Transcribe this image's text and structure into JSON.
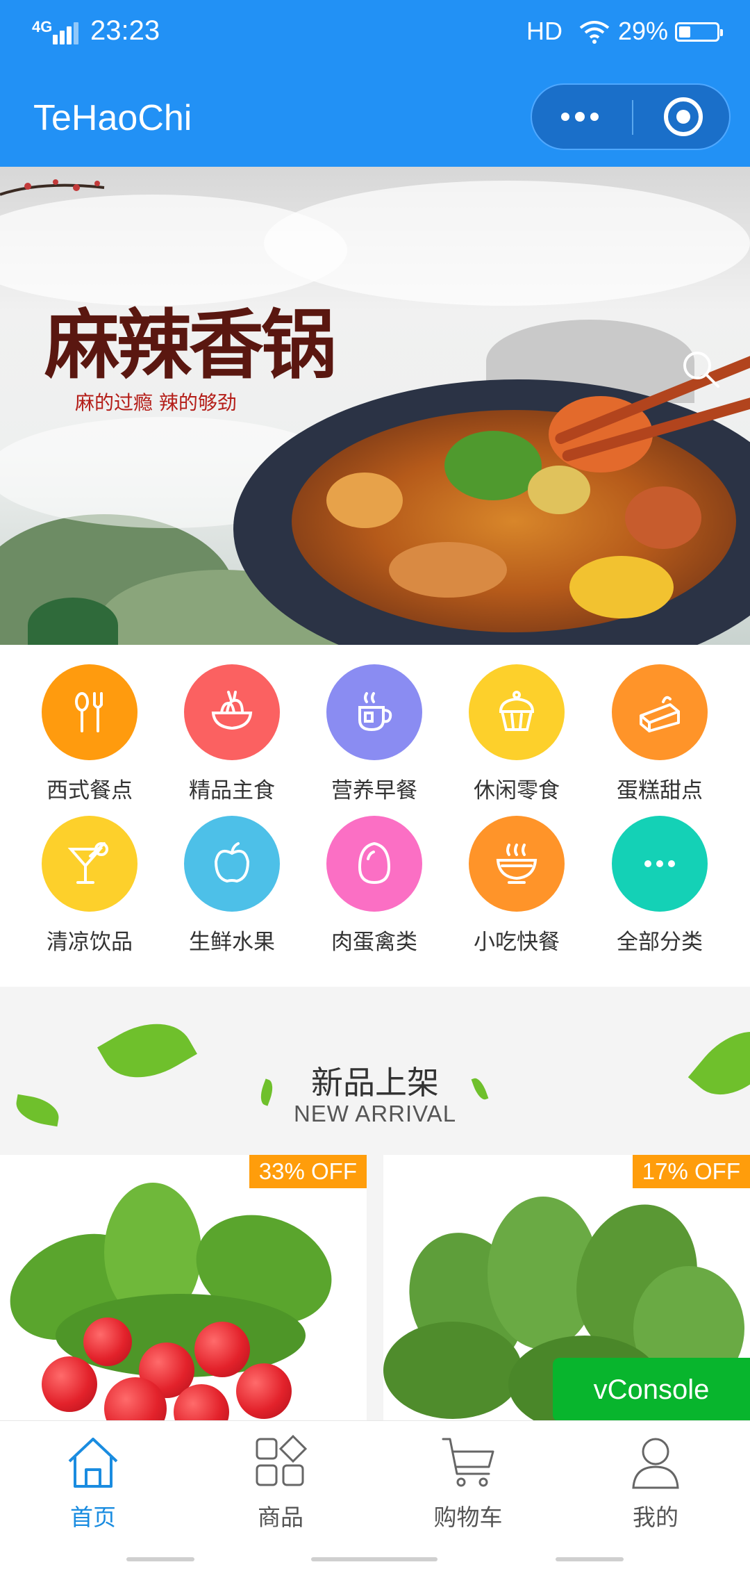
{
  "status_bar": {
    "network": "4G",
    "time": "23:23",
    "hd": "HD",
    "battery": "29%"
  },
  "header": {
    "title": "TeHaoChi"
  },
  "banner": {
    "calligraphy": "麻辣香锅",
    "slogan": "麻的过瘾 辣的够劲",
    "current_slide": 1
  },
  "categories": [
    {
      "label": "西式餐点",
      "color": "#ff9b0e",
      "icon": "fork-spoon-icon"
    },
    {
      "label": "精品主食",
      "color": "#fb6161",
      "icon": "noodle-bowl-icon"
    },
    {
      "label": "营养早餐",
      "color": "#8a8cf2",
      "icon": "coffee-cup-icon"
    },
    {
      "label": "休闲零食",
      "color": "#fdd02b",
      "icon": "cupcake-icon"
    },
    {
      "label": "蛋糕甜点",
      "color": "#ff9429",
      "icon": "cake-slice-icon"
    },
    {
      "label": "清凉饮品",
      "color": "#fdd02b",
      "icon": "cocktail-icon"
    },
    {
      "label": "生鲜水果",
      "color": "#4dc0e8",
      "icon": "apple-icon"
    },
    {
      "label": "肉蛋禽类",
      "color": "#fb6fc4",
      "icon": "egg-icon"
    },
    {
      "label": "小吃快餐",
      "color": "#ff9429",
      "icon": "hot-bowl-icon"
    },
    {
      "label": "全部分类",
      "color": "#14d1b6",
      "icon": "more-dots-icon"
    }
  ],
  "new_arrival": {
    "title_cn": "新品上架",
    "title_en": "NEW ARRIVAL"
  },
  "products": [
    {
      "discount": "33% OFF",
      "image": "radish-image"
    },
    {
      "discount": "17% OFF",
      "image": "spinach-image"
    }
  ],
  "vconsole": "vConsole",
  "tabbar": [
    {
      "label": "首页",
      "icon": "home-icon",
      "active": true
    },
    {
      "label": "商品",
      "icon": "grid-icon",
      "active": false
    },
    {
      "label": "购物车",
      "icon": "cart-icon",
      "active": false
    },
    {
      "label": "我的",
      "icon": "user-icon",
      "active": false
    }
  ],
  "colors": {
    "brand": "#2291f5",
    "accent_active": "#1a8ce0",
    "discount": "#ff9d0b",
    "vconsole": "#08b52d"
  }
}
